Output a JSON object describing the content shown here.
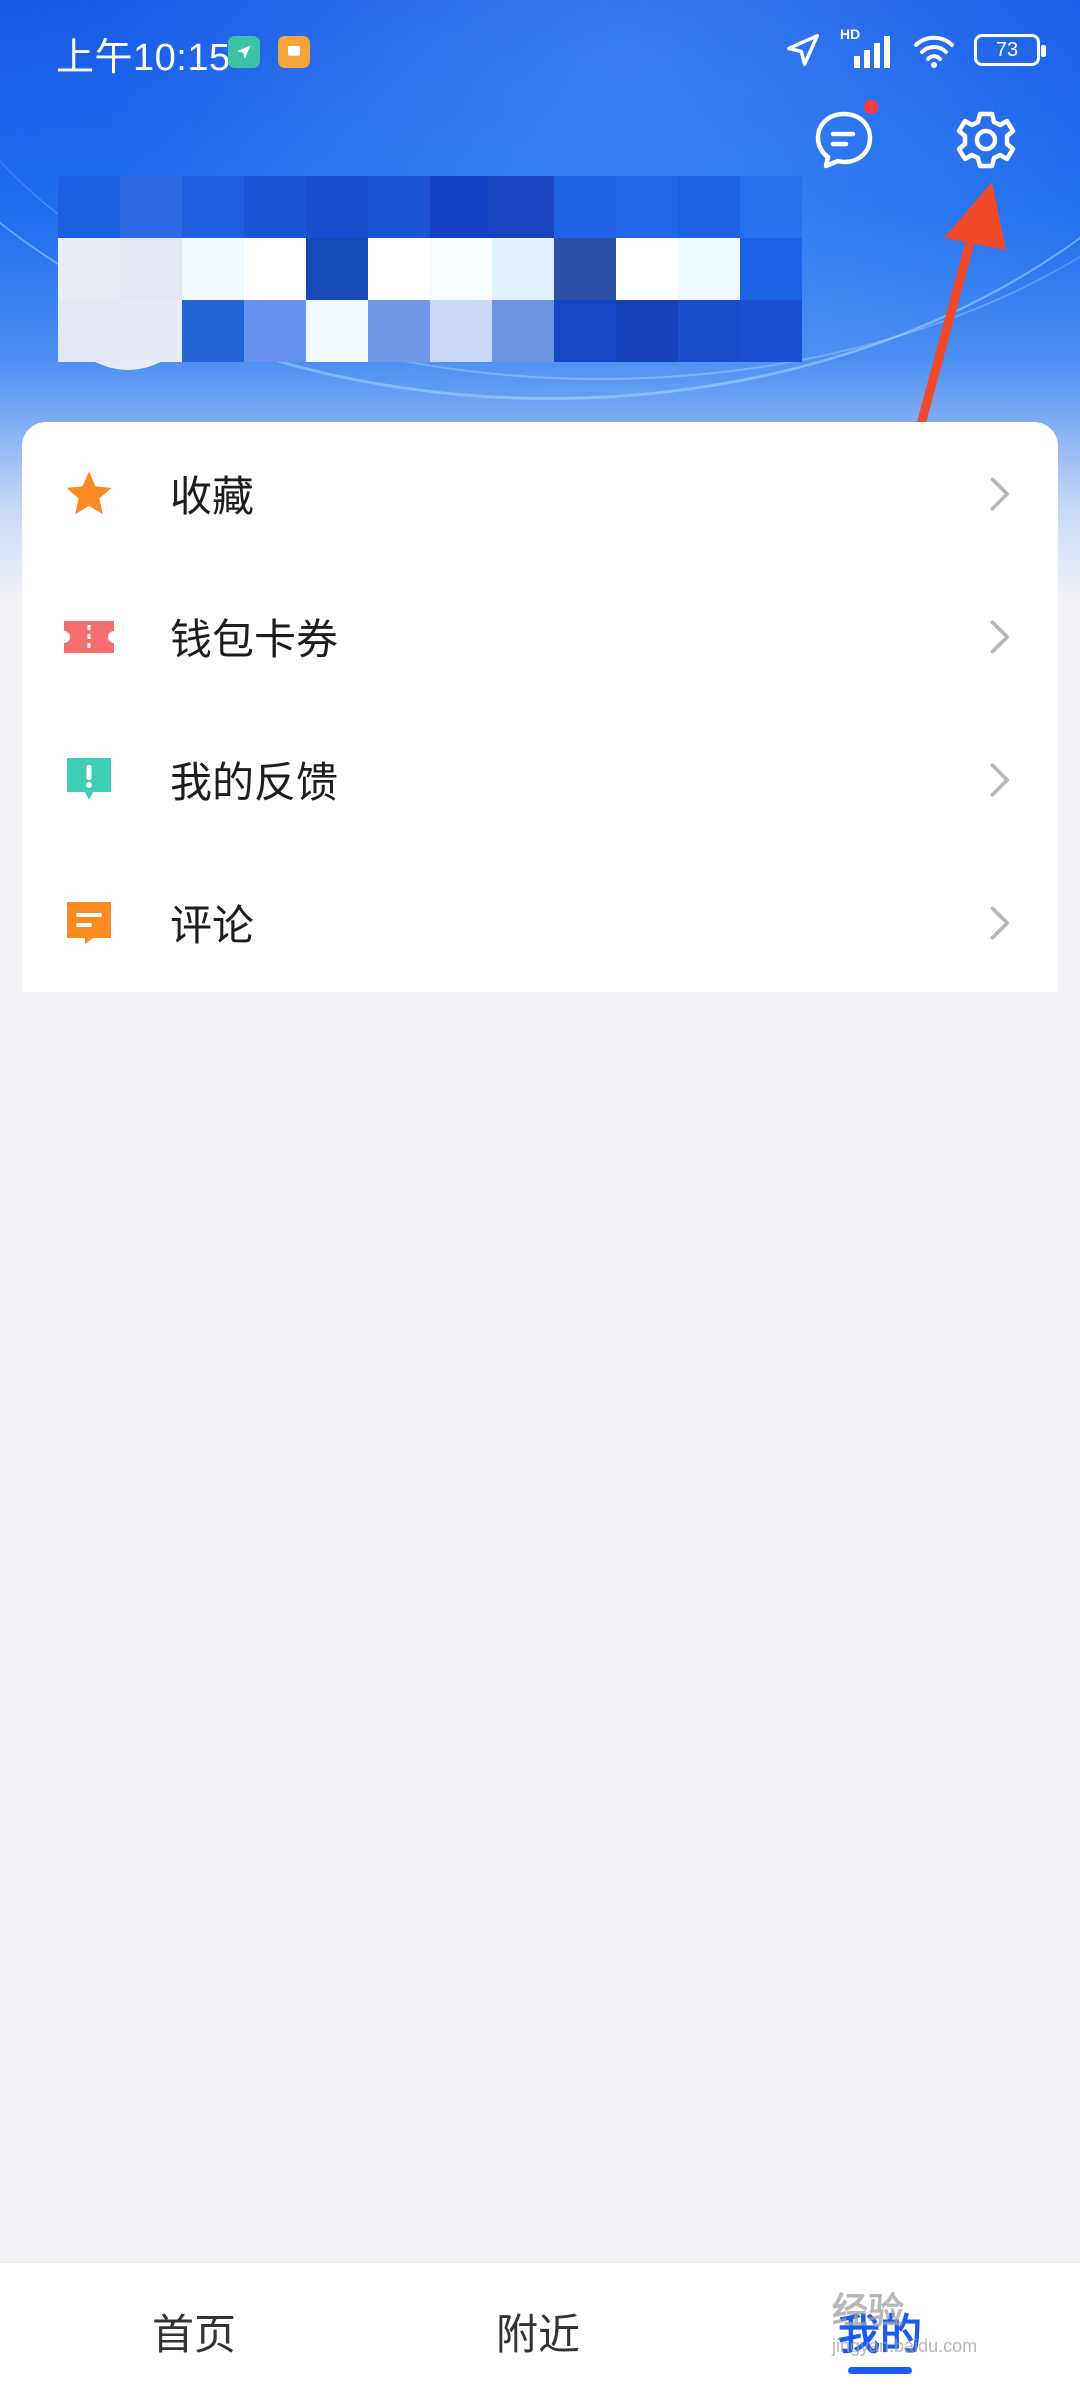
{
  "status_bar": {
    "time": "上午10:15",
    "battery": "73",
    "network_label": "HD"
  },
  "header": {
    "message_icon": "chat-bubble-icon",
    "settings_icon": "gear-icon",
    "message_has_badge": true
  },
  "menu": {
    "items": [
      {
        "label": "收藏",
        "icon": "star-icon",
        "color": "#fb8a23"
      },
      {
        "label": "钱包卡券",
        "icon": "ticket-icon",
        "color": "#f66f6f"
      },
      {
        "label": "我的反馈",
        "icon": "feedback-icon",
        "color": "#3ccfb4"
      },
      {
        "label": "评论",
        "icon": "comment-icon",
        "color": "#fb8a23"
      }
    ]
  },
  "bottom_nav": {
    "tabs": [
      {
        "label": "首页",
        "active": false
      },
      {
        "label": "附近",
        "active": false
      },
      {
        "label": "我的",
        "active": true
      }
    ],
    "accent": "#1a5cf0"
  },
  "watermark": {
    "text": "经验",
    "sub": "jingyan.baidu.com"
  }
}
